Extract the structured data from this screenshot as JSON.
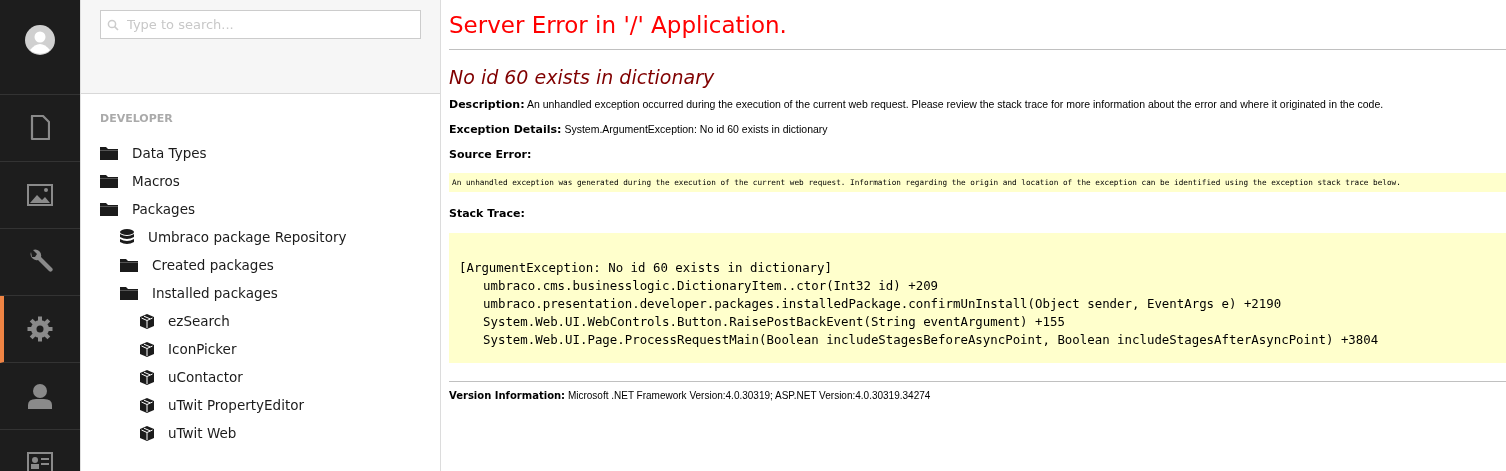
{
  "nav": {
    "items": [
      {
        "selected": false
      },
      {
        "selected": false
      },
      {
        "selected": false
      },
      {
        "selected": true
      },
      {
        "selected": false
      },
      {
        "selected": false
      }
    ]
  },
  "tree": {
    "search": {
      "placeholder": "Type to search..."
    },
    "section_title": "DEVELOPER",
    "items": [
      {
        "kind": "folder",
        "label": "Data Types"
      },
      {
        "kind": "folder",
        "label": "Macros"
      },
      {
        "kind": "folder",
        "label": "Packages",
        "children": [
          {
            "kind": "repository",
            "label": "Umbraco package Repository"
          },
          {
            "kind": "folder",
            "label": "Created packages"
          },
          {
            "kind": "folder",
            "label": "Installed packages",
            "children": [
              {
                "kind": "package",
                "label": "ezSearch"
              },
              {
                "kind": "package",
                "label": "IconPicker"
              },
              {
                "kind": "package",
                "label": "uContactor"
              },
              {
                "kind": "package",
                "label": "uTwit PropertyEditor"
              },
              {
                "kind": "package",
                "label": "uTwit Web"
              }
            ]
          }
        ]
      }
    ]
  },
  "error_page": {
    "title": "Server Error in '/' Application.",
    "message": "No id 60 exists in dictionary",
    "description": {
      "label": "Description:",
      "text": "An unhandled exception occurred during the execution of the current web request. Please review the stack trace for more information about the error and where it originated in the code."
    },
    "exception_details": {
      "label": "Exception Details:",
      "text": "System.ArgumentException: No id 60 exists in dictionary"
    },
    "source_error": {
      "label": "Source Error:",
      "text": "An unhandled exception was generated during the execution of the current web request. Information regarding the origin and location of the exception can be identified using the exception stack trace below."
    },
    "stack_trace": {
      "label": "Stack Trace:",
      "lines": [
        {
          "kind": "header",
          "text": "[ArgumentException: No id 60 exists in dictionary]"
        },
        {
          "kind": "frame",
          "text": "umbraco.cms.businesslogic.DictionaryItem..ctor(Int32 id) +209"
        },
        {
          "kind": "frame",
          "text": "umbraco.presentation.developer.packages.installedPackage.confirmUnInstall(Object sender, EventArgs e) +2190"
        },
        {
          "kind": "frame",
          "text": "System.Web.UI.WebControls.Button.RaisePostBackEvent(String eventArgument) +155"
        },
        {
          "kind": "frame",
          "text": "System.Web.UI.Page.ProcessRequestMain(Boolean includeStagesBeforeAsyncPoint, Boolean includeStagesAfterAsyncPoint) +3804"
        }
      ]
    },
    "version": {
      "label": "Version Information:",
      "text": "Microsoft .NET Framework Version:4.0.30319; ASP.NET Version:4.0.30319.34274"
    }
  }
}
